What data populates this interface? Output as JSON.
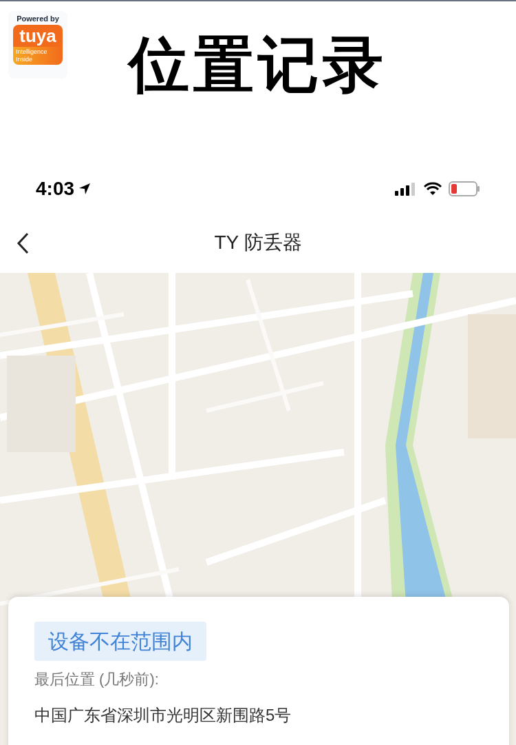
{
  "promo": {
    "logo": {
      "powered": "Powered by",
      "brand": "tuya",
      "tagline_1": "Intelligence",
      "tagline_2": "Inside"
    },
    "title": "位置记录"
  },
  "status_bar": {
    "time": "4:03"
  },
  "nav": {
    "title": "TY 防丢器"
  },
  "card": {
    "status": "设备不在范围内",
    "label": "最后位置 (几秒前):",
    "address": "中国广东省深圳市光明区新围路5号"
  }
}
